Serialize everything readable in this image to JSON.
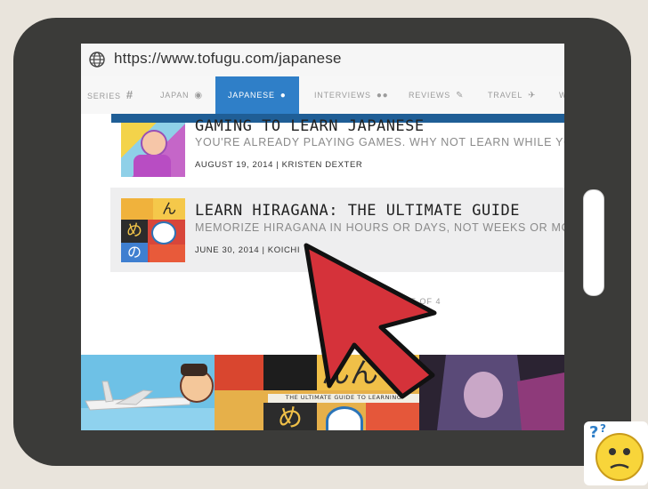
{
  "browser": {
    "url": "https://www.tofugu.com/japanese"
  },
  "nav": {
    "tabs": [
      {
        "label": "SERIES",
        "icon": "hash-icon",
        "active": false
      },
      {
        "label": "JAPAN",
        "icon": "globe-icon",
        "active": false
      },
      {
        "label": "JAPANESE",
        "icon": "speech-bubbles-icon",
        "active": true
      },
      {
        "label": "INTERVIEWS",
        "icon": "users-icon",
        "active": false
      },
      {
        "label": "REVIEWS",
        "icon": "pencil-icon",
        "active": false
      },
      {
        "label": "TRAVEL",
        "icon": "plane-icon",
        "active": false
      },
      {
        "label": "W",
        "icon": "",
        "active": false
      }
    ]
  },
  "posts": [
    {
      "title": "GAMING TO LEARN JAPANESE",
      "subtitle": "YOU'RE ALREADY PLAYING GAMES. WHY NOT LEARN WHILE YOU DO IT?!",
      "date": "AUGUST 19, 2014",
      "author": "KRISTEN DEXTER"
    },
    {
      "title": "LEARN HIRAGANA: THE ULTIMATE GUIDE",
      "subtitle": "MEMORIZE HIRAGANA IN HOURS OR DAYS, NOT WEEKS OR MONTHS.",
      "date": "JUNE 30, 2014",
      "author": "KOICHI",
      "thumb_kana": [
        "ん",
        "め",
        "の"
      ]
    }
  ],
  "pager": {
    "text": "E OF 4"
  },
  "banner": {
    "caption": "THE ULTIMATE GUIDE TO LEARNING",
    "kana_top": "んん",
    "kana_bottom": "め"
  },
  "colors": {
    "accent": "#2f7fc8",
    "nav_underline": "#1f5e96",
    "arrow": "#d5323a",
    "tablet": "#3b3b39"
  }
}
